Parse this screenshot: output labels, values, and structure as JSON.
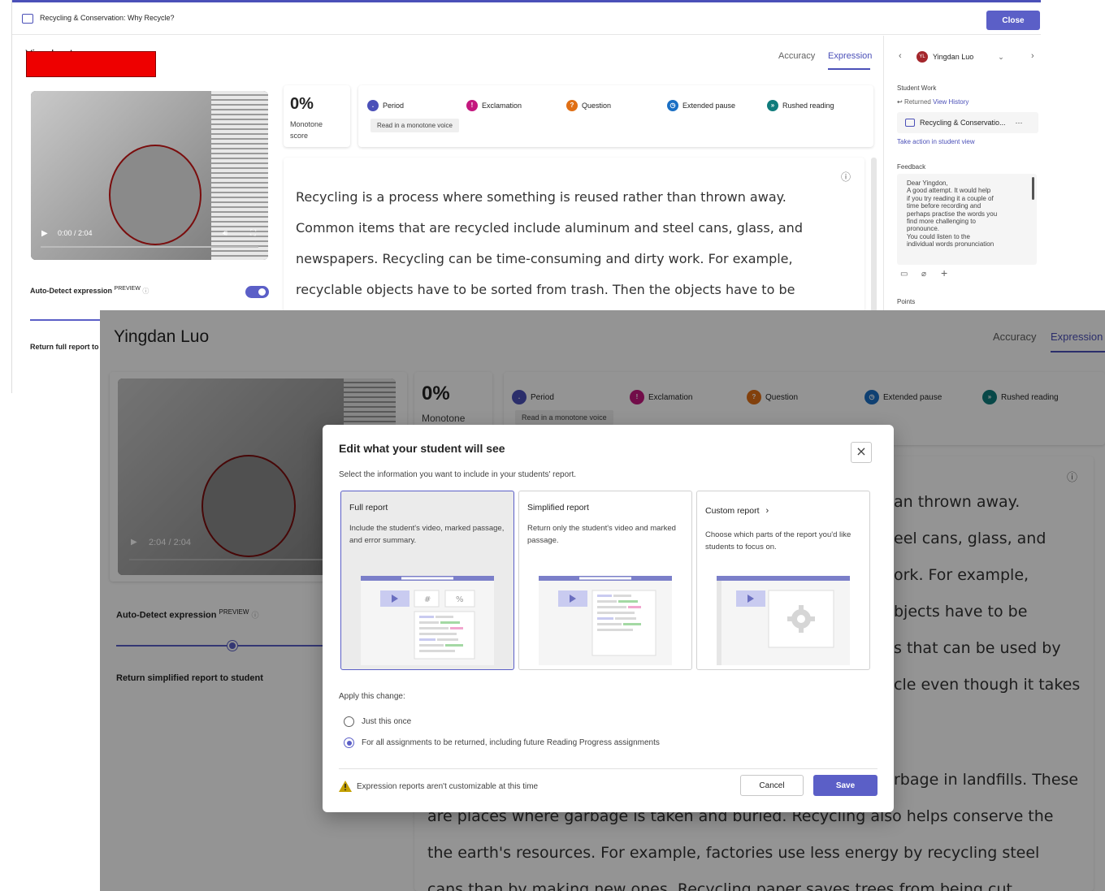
{
  "background_window": {
    "title": "Recycling & Conservation: Why Recycle?",
    "close_label": "Close",
    "student_name": "Yingdan Luo",
    "tabs": {
      "accuracy": "Accuracy",
      "expression": "Expression"
    },
    "video_time": "0:00 / 2:04",
    "score": {
      "value": "0%",
      "label_line1": "Monotone",
      "label_line2": "score"
    },
    "legend": {
      "period": "Period",
      "exclamation": "Exclamation",
      "question": "Question",
      "extended_pause": "Extended pause",
      "rushed_reading": "Rushed reading",
      "chip": "Read in a monotone voice"
    },
    "passage_lines": [
      "Recycling is a process where something is reused rather than thrown away.",
      "Common items that are recycled include aluminum and steel cans, glass, and",
      "newspapers. Recycling can be time-consuming and dirty work. For example,",
      "recyclable objects have to be sorted from trash. Then the objects have to be"
    ],
    "auto_detect_label": "Auto-Detect expression",
    "preview_label": "PREVIEW",
    "return_label": "Return full report to",
    "sidebar": {
      "student": "Yingdan Luo",
      "avatar_initials": "YL",
      "student_work_label": "Student Work",
      "returned_label": "Returned",
      "view_history": "View History",
      "assignment": "Recycling & Conservatio...",
      "more": "···",
      "take_action": "Take action in student view",
      "feedback_label": "Feedback",
      "feedback_lines": [
        "Dear Yingdon,",
        "A good attempt. It would help",
        "if you try reading it a couple of",
        "time before recording and",
        "perhaps practise the words you",
        "find more challenging to",
        "pronounce.",
        "You could listen to the",
        "individual words pronunciation"
      ],
      "points_label": "Points"
    }
  },
  "foreground_window": {
    "student_name": "Yingdan Luo",
    "tabs": {
      "accuracy": "Accuracy",
      "expression": "Expression"
    },
    "video_time": "2:04 / 2:04",
    "score": {
      "value": "0%",
      "label_line1": "Monotone"
    },
    "legend": {
      "period": "Period",
      "exclamation": "Exclamation",
      "question": "Question",
      "extended_pause": "Extended pause",
      "rushed_reading": "Rushed reading",
      "chip": "Read in a monotone voice"
    },
    "auto_detect_label": "Auto-Detect expression",
    "preview_label": "PREVIEW",
    "return_label": "Return simplified report to student",
    "passage_fragments": [
      "an thrown away.",
      "eel cans, glass, and",
      "ork. For example,",
      "bjects have to be",
      "s that can be used by",
      "cle even though it takes",
      "rbage in landfills. These"
    ],
    "passage_lines_bottom": [
      "are places where garbage is taken and buried. Recycling also helps conserve the",
      "the earth's resources. For example, factories use less energy by recycling steel",
      "cans than by making new ones. Recycling paper saves trees from being cut"
    ]
  },
  "modal": {
    "title": "Edit what your student will see",
    "subtitle": "Select the information you want to include in your students' report.",
    "cards": [
      {
        "title": "Full report",
        "description": "Include the student's video, marked passage, and error summary.",
        "selected": true
      },
      {
        "title": "Simplified report",
        "description": "Return only the student's video and marked passage.",
        "selected": false
      },
      {
        "title": "Custom report",
        "description": "Choose which parts of the report you'd like students to focus on.",
        "selected": false
      }
    ],
    "illus_hash": "#",
    "illus_percent": "%",
    "apply_label": "Apply this change:",
    "radio_once": "Just this once",
    "radio_all": "For all assignments to be returned, including future Reading Progress assignments",
    "radio_selected": "all",
    "warning": "Expression reports aren't customizable at this time",
    "cancel_label": "Cancel",
    "save_label": "Save"
  },
  "colors": {
    "accent": "#5b5fc7",
    "period": "#4b50b8",
    "exclamation": "#c4177e",
    "question": "#e06f15",
    "extended_pause": "#1a6fc4",
    "rushed_reading": "#0f7c7c",
    "warning": "#c4a000"
  }
}
